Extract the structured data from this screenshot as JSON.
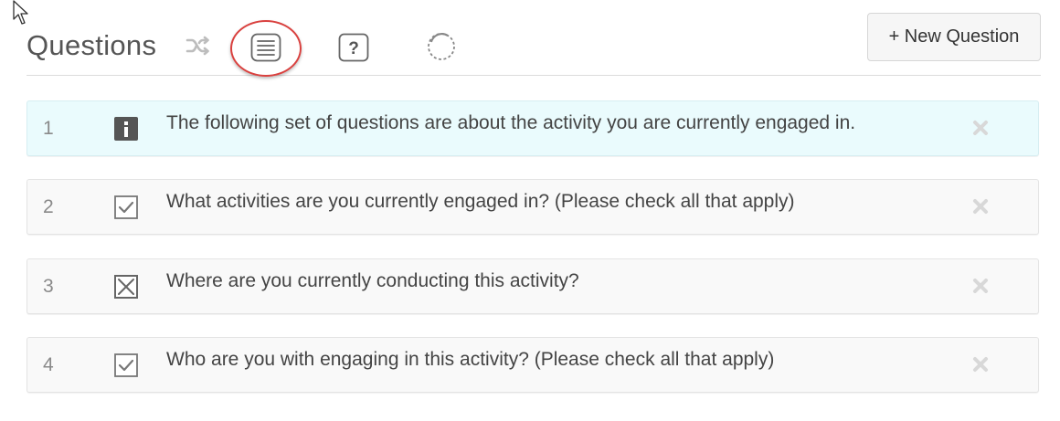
{
  "header": {
    "title": "Questions",
    "new_question_label": "+ New Question",
    "tools": [
      {
        "icon": "shuffle-icon"
      },
      {
        "icon": "list-icon",
        "highlighted": true
      },
      {
        "icon": "help-icon"
      },
      {
        "icon": "loop-icon"
      }
    ]
  },
  "questions": [
    {
      "number": "1",
      "type_icon": "info-icon",
      "text": "The following set of questions are about the activity you are currently engaged in.",
      "highlighted": true
    },
    {
      "number": "2",
      "type_icon": "checkbox-checked-icon",
      "text": "What activities are you currently engaged in? (Please check all that apply)"
    },
    {
      "number": "3",
      "type_icon": "radio-x-icon",
      "text": "Where are you currently conducting this activity?"
    },
    {
      "number": "4",
      "type_icon": "checkbox-checked-icon",
      "text": "Who are you with engaging in this activity? (Please check all that apply)"
    }
  ],
  "colors": {
    "highlight_ring": "#d9413f",
    "info_row_bg": "#eafbfd",
    "row_bg": "#f9f9f9"
  }
}
